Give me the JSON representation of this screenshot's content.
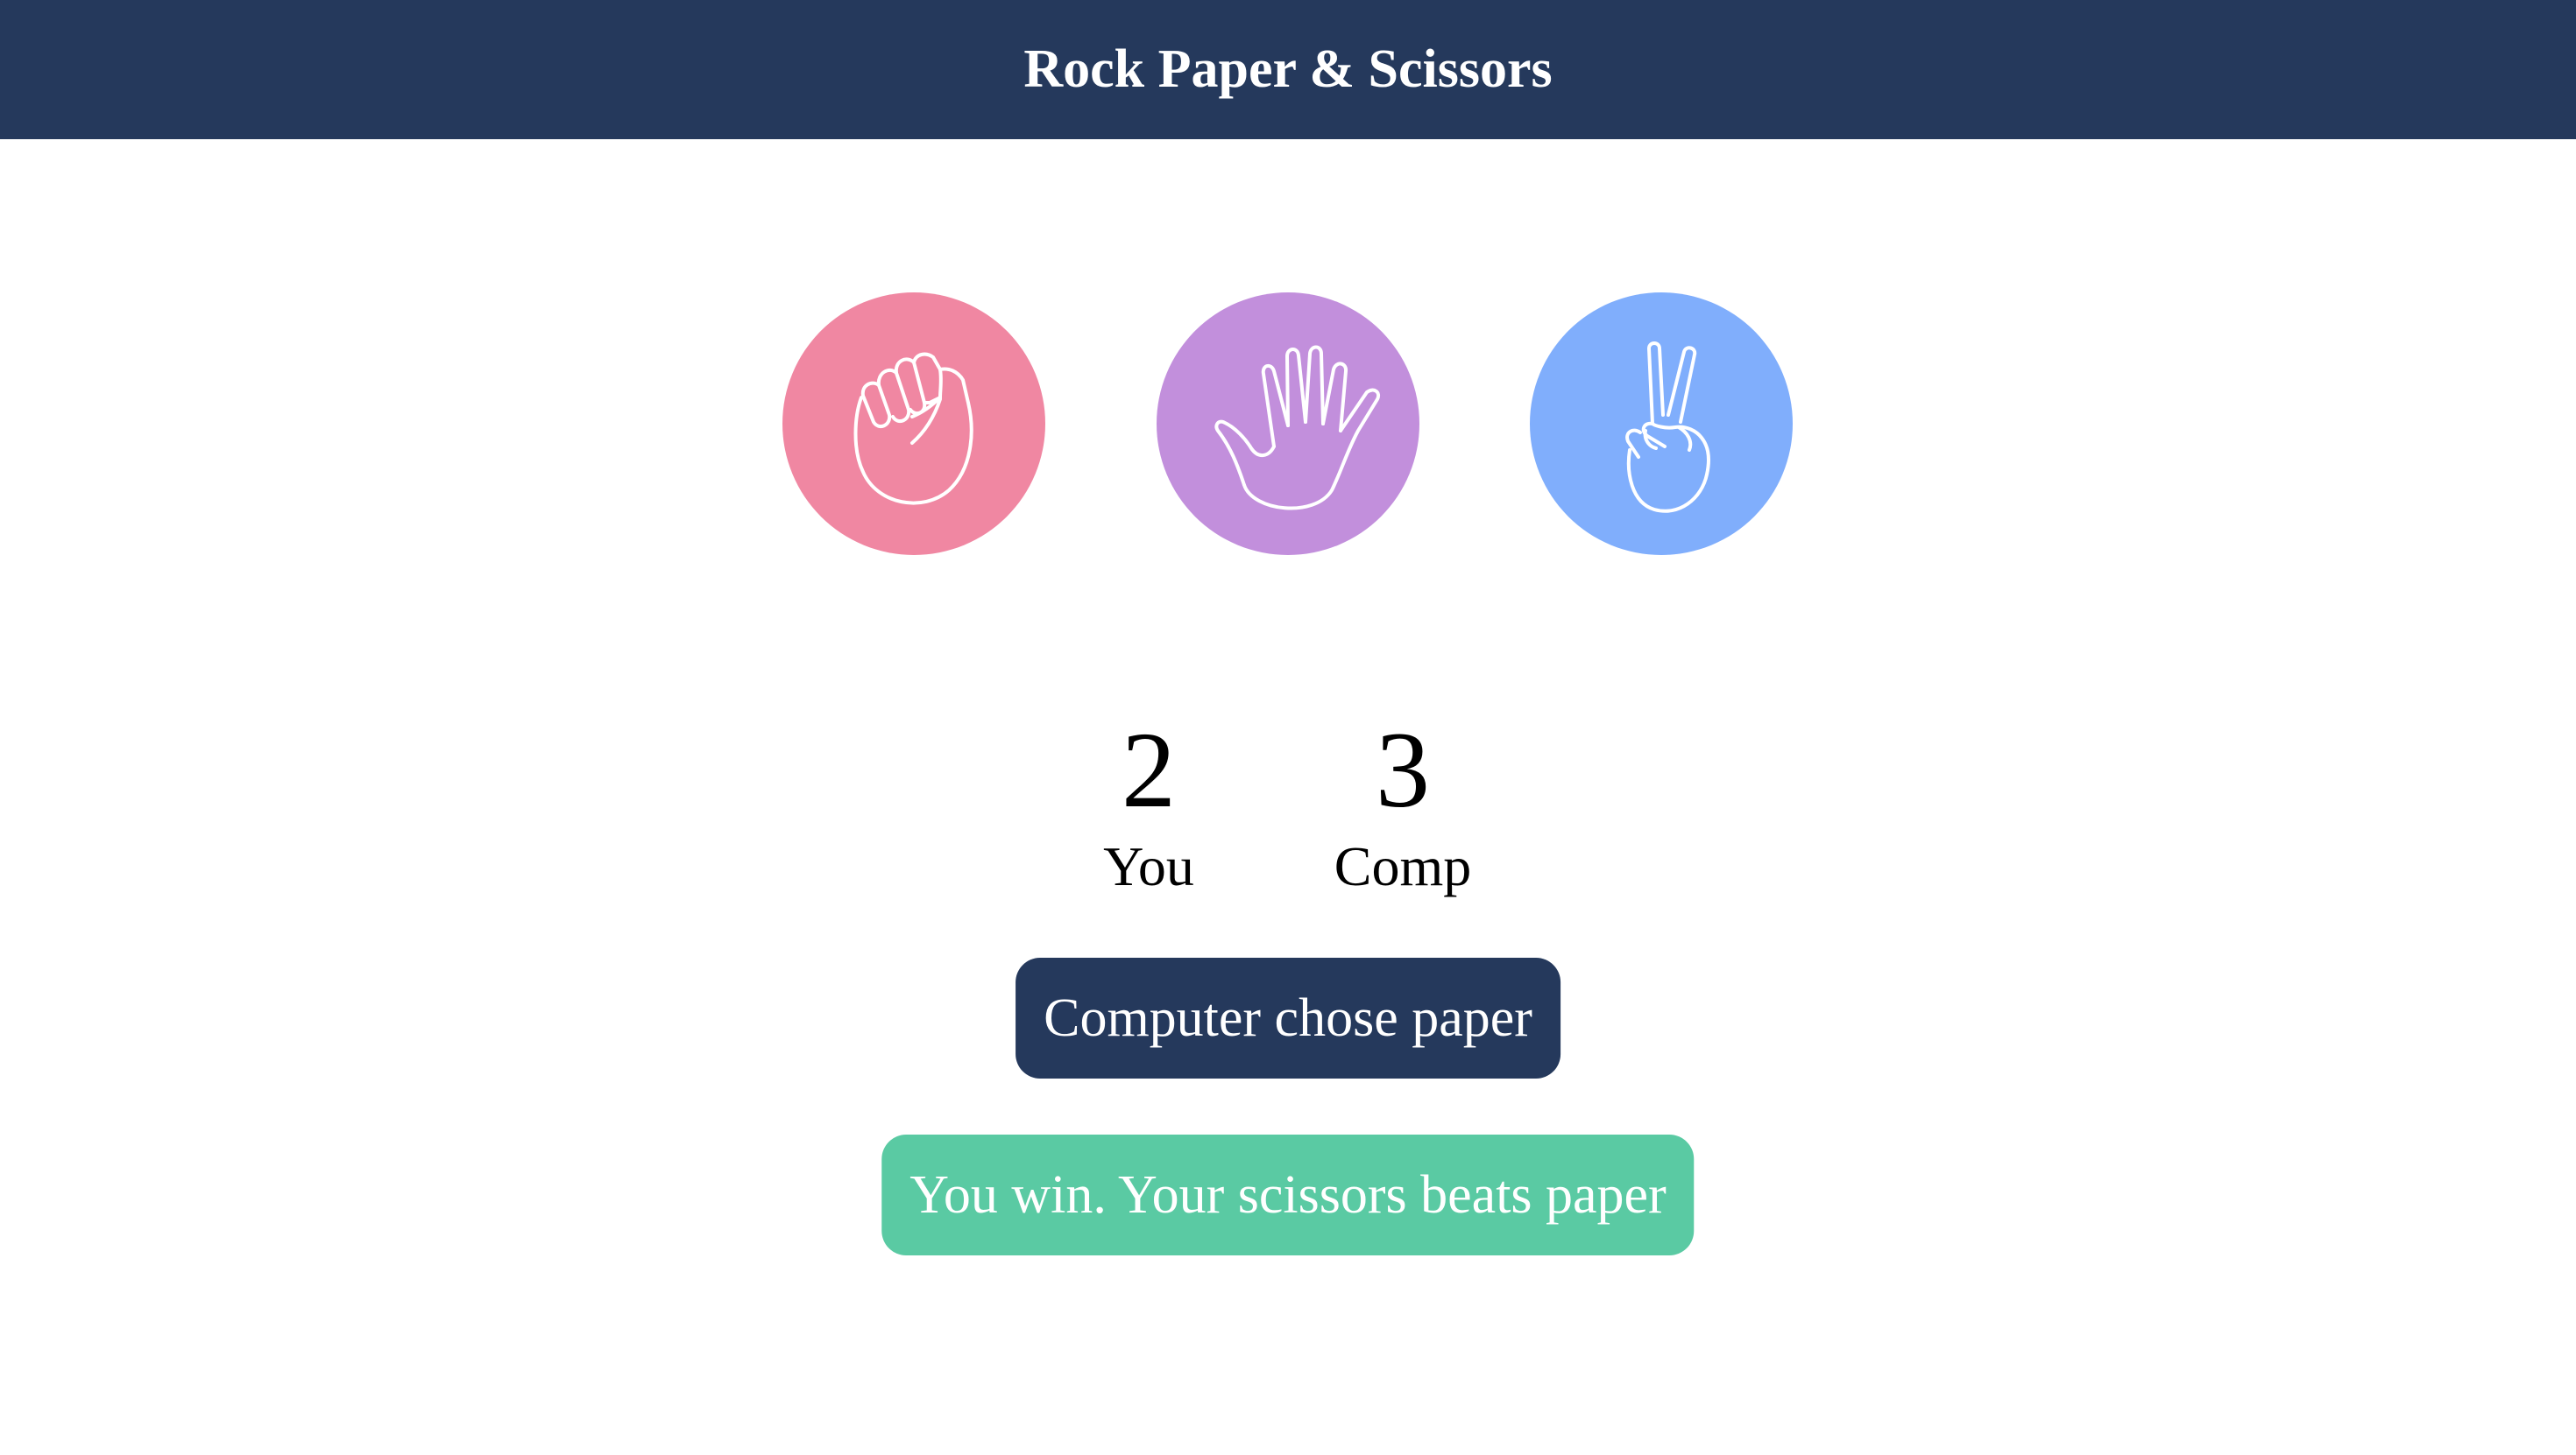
{
  "header": {
    "title": "Rock Paper & Scissors"
  },
  "choices": [
    {
      "name": "rock",
      "icon": "fist-icon",
      "color": "#f087a2"
    },
    {
      "name": "paper",
      "icon": "open-hand-icon",
      "color": "#c28fdc"
    },
    {
      "name": "scissors",
      "icon": "peace-hand-icon",
      "color": "#80aefc"
    }
  ],
  "scores": {
    "you": {
      "value": "2",
      "label": "You"
    },
    "comp": {
      "value": "3",
      "label": "Comp"
    }
  },
  "messages": {
    "computer_choice": {
      "text": "Computer chose paper",
      "color": "#25395c"
    },
    "result": {
      "text": "You win. Your scissors beats paper",
      "color": "#5acaa3"
    }
  }
}
